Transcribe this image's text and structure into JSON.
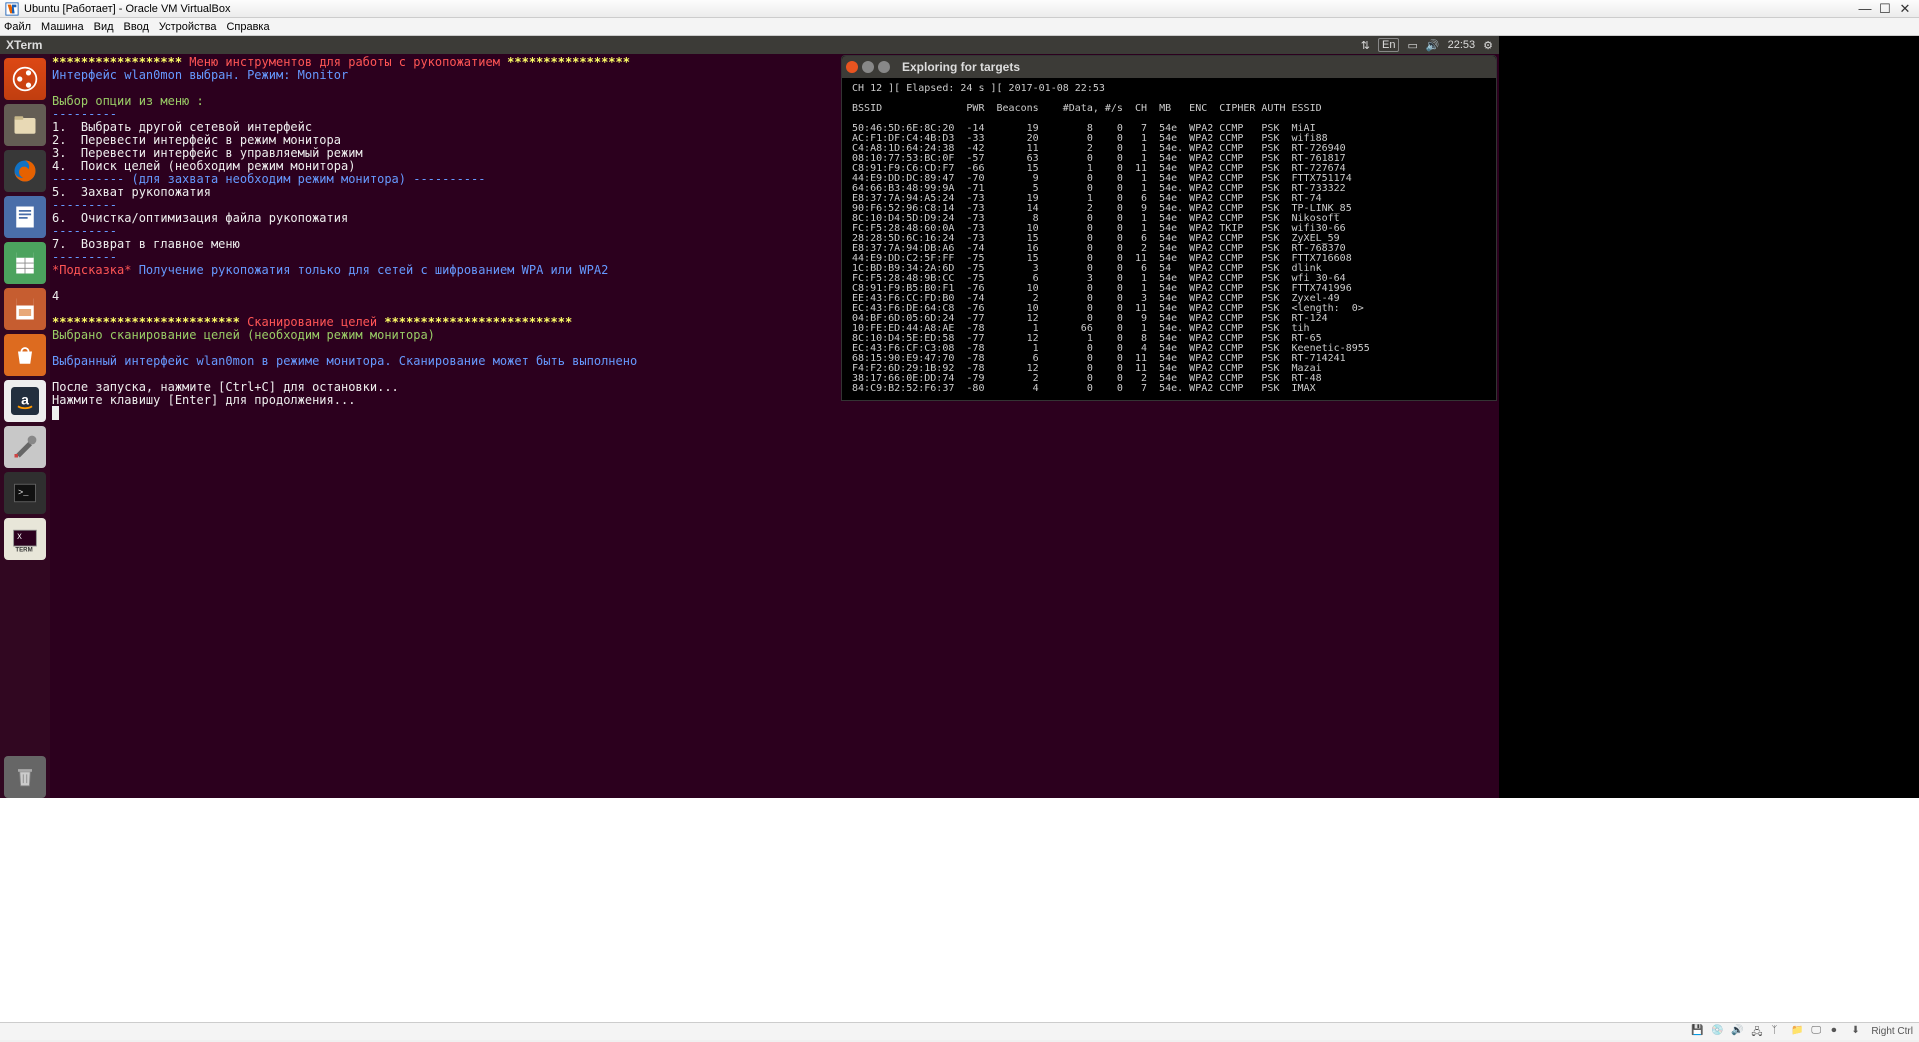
{
  "vbox": {
    "title": "Ubuntu [Работает] - Oracle VM VirtualBox",
    "menu": [
      "Файл",
      "Машина",
      "Вид",
      "Ввод",
      "Устройства",
      "Справка"
    ],
    "status_hostkey": "Right Ctrl"
  },
  "unity": {
    "title": "XTerm",
    "lang": "En",
    "time": "22:53"
  },
  "xterm": {
    "header_stars1": "******************",
    "header_title": " Меню инструментов для работы с рукопожатием ",
    "header_stars2": "*****************",
    "iface_line1": "Интерфейс wlan0mon выбран. ",
    "iface_mode": "Режим: Monitor",
    "select_opt": "Выбор опции из меню :",
    "hr": "---------",
    "items": [
      "1.  Выбрать другой сетевой интерфейс",
      "2.  Перевести интерфейс в режим монитора",
      "3.  Перевести интерфейс в управляемый режим",
      "4.  Поиск целей (необходим режим монитора)"
    ],
    "capture_note": "---------- (для захвата необходим режим монитора) ----------",
    "item5": "5.  Захват рукопожатия",
    "item6": "6.  Очистка/оптимизация файла рукопожатия",
    "item7": "7.  Возврат в главное меню",
    "hint_label": "*Подсказка*",
    "hint_text": " Получение рукопожатия только для сетей с шифрованием WPA или WPA2",
    "input_val": "4",
    "scan_stars1": "**************************",
    "scan_title": " Сканирование целей ",
    "scan_stars2": "**************************",
    "scan_selected": "Выбрано сканирование целей (необходим режим монитора)",
    "scan_iface": "Выбранный интерфейс wlan0mon в режиме монитора. Сканирование может быть выполнено",
    "after_launch": "После запуска, нажмите [Ctrl+C] для остановки...",
    "press_enter": "Нажмите клавишу [Enter] для продолжения...",
    "cursor": " "
  },
  "explore": {
    "title": "Exploring for targets",
    "status_line": " CH 12 ][ Elapsed: 24 s ][ 2017-01-08 22:53",
    "header": " BSSID              PWR  Beacons    #Data, #/s  CH  MB   ENC  CIPHER AUTH ESSID",
    "rows": [
      " 50:46:5D:6E:8C:20  -14       19        8    0   7  54e  WPA2 CCMP   PSK  MiAI",
      " AC:F1:DF:C4:4B:D3  -33       20        0    0   1  54e  WPA2 CCMP   PSK  wifi88",
      " C4:A8:1D:64:24:38  -42       11        2    0   1  54e. WPA2 CCMP   PSK  RT-726940",
      " 08:10:77:53:BC:0F  -57       63        0    0   1  54e  WPA2 CCMP   PSK  RT-761817",
      " C8:91:F9:C6:CD:F7  -66       15        1    0  11  54e  WPA2 CCMP   PSK  RT-727674",
      " 44:E9:DD:DC:89:47  -70        9        0    0   1  54e  WPA2 CCMP   PSK  FTTX751174",
      " 64:66:B3:48:99:9A  -71        5        0    0   1  54e. WPA2 CCMP   PSK  RT-733322",
      " E8:37:7A:94:A5:24  -73       19        1    0   6  54e  WPA2 CCMP   PSK  RT-74",
      " 90:F6:52:96:C8:14  -73       14        2    0   9  54e. WPA2 CCMP   PSK  TP-LINK_85",
      " 8C:10:D4:5D:D9:24  -73        8        0    0   1  54e  WPA2 CCMP   PSK  Nikosoft",
      " FC:F5:28:48:60:0A  -73       10        0    0   1  54e  WPA2 TKIP   PSK  wifi30-66",
      " 28:28:5D:6C:16:24  -73       15        0    0   6  54e  WPA2 CCMP   PSK  ZyXEL_59",
      " E8:37:7A:94:DB:A6  -74       16        0    0   2  54e  WPA2 CCMP   PSK  RT-768370",
      " 44:E9:DD:C2:5F:FF  -75       15        0    0  11  54e  WPA2 CCMP   PSK  FTTX716608",
      " 1C:BD:B9:34:2A:6D  -75        3        0    0   6  54   WPA2 CCMP   PSK  dlink",
      " FC:F5:28:48:9B:CC  -75        6        3    0   1  54e  WPA2 CCMP   PSK  wfi 30-64",
      " C8:91:F9:B5:B0:F1  -76       10        0    0   1  54e  WPA2 CCMP   PSK  FTTX741996",
      " EE:43:F6:CC:FD:B0  -74        2        0    0   3  54e  WPA2 CCMP   PSK  Zyxel-49",
      " EC:43:F6:DE:64:C8  -76       10        0    0  11  54e  WPA2 CCMP   PSK  <length:  0>",
      " 04:BF:6D:05:6D:24  -77       12        0    0   9  54e  WPA2 CCMP   PSK  RT-124",
      " 10:FE:ED:44:A8:AE  -78        1       66    0   1  54e. WPA2 CCMP   PSK  tih",
      " 8C:10:D4:5E:ED:58  -77       12        1    0   8  54e  WPA2 CCMP   PSK  RT-65",
      " EC:43:F6:CF:C3:08  -78        1        0    0   4  54e  WPA2 CCMP   PSK  Keenetic-8955",
      " 68:15:90:E9:47:70  -78        6        0    0  11  54e  WPA2 CCMP   PSK  RT-714241",
      " F4:F2:6D:29:1B:92  -78       12        0    0  11  54e  WPA2 CCMP   PSK  Mazai",
      " 38:17:66:0E:DD:74  -79        2        0    0   2  54e  WPA2 CCMP   PSK  RT-48",
      " 84:C9:B2:52:F6:37  -80        4        0    0   7  54e. WPA2 CCMP   PSK  IMAX"
    ]
  }
}
